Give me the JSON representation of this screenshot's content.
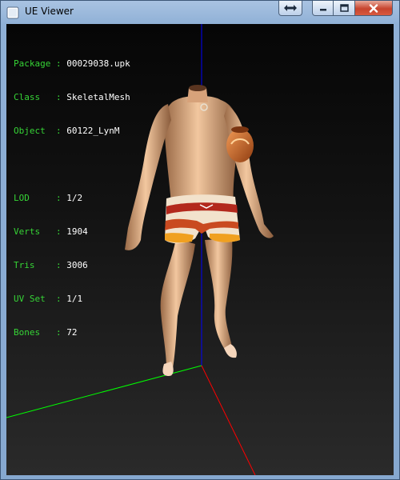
{
  "window": {
    "title": "UE Viewer"
  },
  "hud": {
    "group1": [
      {
        "key": "Package",
        "value": "00029038.upk"
      },
      {
        "key": "Class  ",
        "value": "SkeletalMesh"
      },
      {
        "key": "Object ",
        "value": "60122_LynM"
      }
    ],
    "group2": [
      {
        "key": "LOD    ",
        "value": "1/2"
      },
      {
        "key": "Verts  ",
        "value": "1904"
      },
      {
        "key": "Tris   ",
        "value": "3006"
      },
      {
        "key": "UV Set ",
        "value": "1/1"
      },
      {
        "key": "Bones  ",
        "value": "72"
      }
    ],
    "separator": " : "
  },
  "colors": {
    "label": "#36d436",
    "value": "#ffffff",
    "axis_x": "#ff0000",
    "axis_y": "#00ff00",
    "axis_z": "#0000ff"
  }
}
